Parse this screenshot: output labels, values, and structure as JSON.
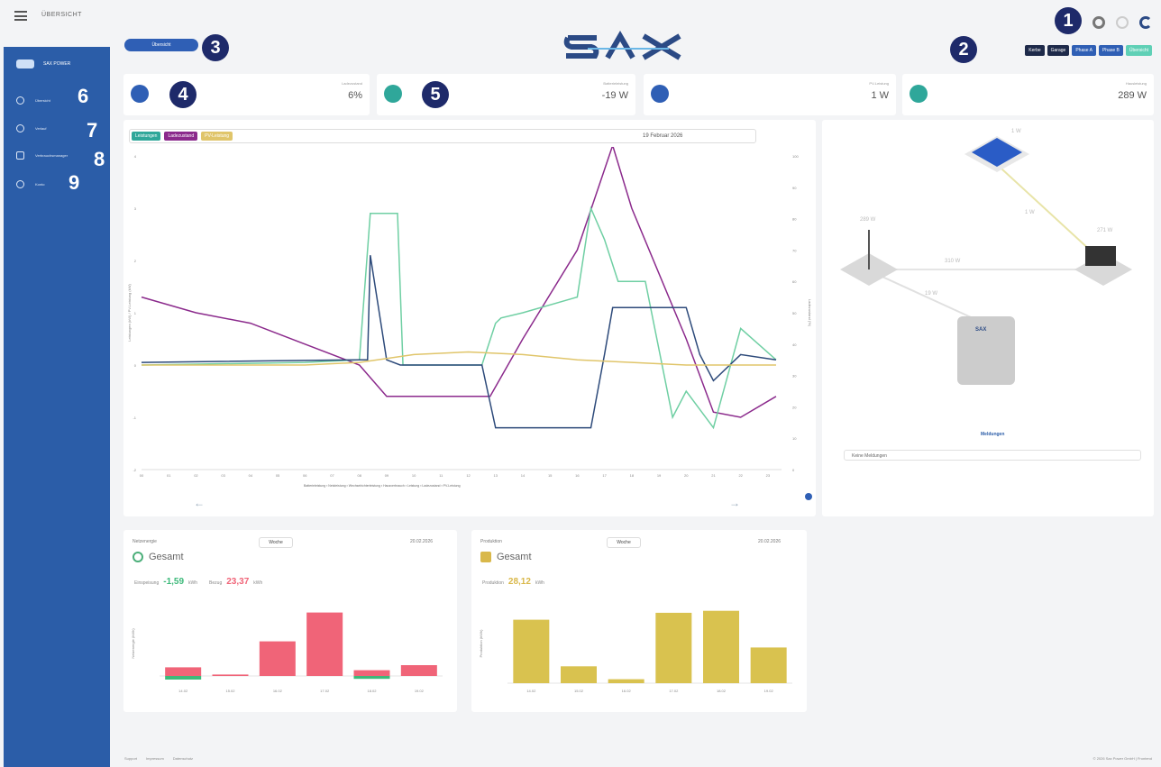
{
  "header": {
    "breadcrumb": "ÜBERSICHT",
    "logo_text": "SAX"
  },
  "sidebar": {
    "brand": "SAX POWER",
    "items": [
      {
        "label": "Übersicht"
      },
      {
        "label": "Verlauf"
      },
      {
        "label": "Verbrauchsmanager"
      },
      {
        "label": "Konto"
      }
    ]
  },
  "overview_pill": "Übersicht",
  "phase_buttons": [
    "Kerbe",
    "Garage",
    "Phase A",
    "Phase B",
    "Übersicht"
  ],
  "stats": [
    {
      "label": "Ladezustand",
      "value": "6%"
    },
    {
      "label": "Batterieleistung",
      "value": "-19 W"
    },
    {
      "label": "PV-Leistung",
      "value": "1 W"
    },
    {
      "label": "Hausleistung",
      "value": "289 W"
    }
  ],
  "chart": {
    "chips": [
      "Leistungen",
      "Ladezustand",
      "PV-Leistung"
    ],
    "date": "19 Februar 2026",
    "legend_text": "Batterieleistung ▪ Netzleistung ▪ Wechselrichterleistung ▪ Hausverbrauch ▪ Leistung ▪ Ladezustand ▪ PV-Leistung"
  },
  "chart_data": {
    "type": "line",
    "title": "",
    "ylabel": "Leistungen (kW) / PV-Leistung (kW)",
    "y2label": "Ladezustand (%)",
    "ylim": [
      -2,
      4
    ],
    "y2lim": [
      0,
      100
    ],
    "x_ticks": [
      "00",
      "01",
      "02",
      "03",
      "04",
      "05",
      "06",
      "07",
      "08",
      "09",
      "10",
      "11",
      "12",
      "13",
      "14",
      "15",
      "16",
      "17",
      "18",
      "19",
      "20",
      "21",
      "22",
      "23"
    ],
    "yticks": [
      -2,
      -1,
      0,
      1,
      2,
      3,
      4
    ],
    "y2ticks": [
      0,
      10,
      20,
      30,
      40,
      50,
      60,
      70,
      80,
      90,
      100
    ],
    "series": [
      {
        "color": "#8b2a8c",
        "x": [
          0,
          2,
          4,
          6,
          8,
          9,
          11,
          12.8,
          14,
          16,
          17.3,
          18,
          20,
          21,
          22,
          23.3
        ],
        "y": [
          1.3,
          1.0,
          0.8,
          0.4,
          0.0,
          -0.6,
          -0.6,
          -0.6,
          0.5,
          2.2,
          4.2,
          3.0,
          0.5,
          -0.9,
          -1.0,
          -0.6
        ]
      },
      {
        "color": "#6fcfa3",
        "x": [
          0,
          6,
          8,
          8.4,
          9.4,
          9.6,
          11,
          12.5,
          13,
          13.2,
          14,
          16,
          16.5,
          17,
          17.5,
          18.5,
          19.5,
          20,
          21,
          22,
          23.3
        ],
        "y": [
          0,
          0.05,
          0.1,
          2.9,
          2.9,
          0,
          0,
          0,
          0.8,
          0.9,
          1.0,
          1.3,
          3.0,
          2.4,
          1.6,
          1.6,
          -1.0,
          -0.5,
          -1.2,
          0.7,
          0.1
        ]
      },
      {
        "color": "#2d4a7a",
        "x": [
          0,
          8,
          8.3,
          8.4,
          9,
          9.5,
          11,
          12.5,
          13,
          16.5,
          17,
          17.3,
          20,
          20.5,
          21,
          22,
          23.3
        ],
        "y": [
          0.05,
          0.1,
          0.1,
          2.1,
          0.1,
          0,
          0,
          0,
          -1.2,
          -1.2,
          0.2,
          1.1,
          1.1,
          0.2,
          -0.3,
          0.2,
          0.1
        ]
      },
      {
        "color": "#e0c56a",
        "x": [
          0,
          6,
          8,
          10,
          12,
          14,
          16,
          18,
          20,
          23.3
        ],
        "y": [
          0,
          0,
          0.05,
          0.2,
          0.25,
          0.2,
          0.1,
          0.05,
          0,
          0
        ]
      }
    ]
  },
  "flow": {
    "pv_label": "1 W",
    "pv_to_house": "1 W",
    "grid_label": "289 W",
    "grid_to_house": "310 W",
    "house_label": "271 W",
    "battery_flow": "19 W",
    "battery_logo": "SAX"
  },
  "meldungen": {
    "title": "Meldungen",
    "item": "Keine Meldungen"
  },
  "bottom_left": {
    "meta": "Netzenergie",
    "title": "Gesamt",
    "week_btn": "Woche",
    "date": "20.02.2026",
    "feed_in_label": "Einspeisung",
    "feed_in_value": "-1,59",
    "feed_in_unit": "kWh",
    "consumption_label": "Bezug",
    "consumption_value": "23,37",
    "consumption_unit": "kWh",
    "ylabel": "Netzenergie (kWh)"
  },
  "bottom_right": {
    "meta": "Produktion",
    "title": "Gesamt",
    "week_btn": "Woche",
    "date": "20.02.2026",
    "prod_label": "Produktion",
    "prod_value": "28,12",
    "prod_unit": "kWh",
    "ylabel": "Produktion (kWh)"
  },
  "bar_left_data": {
    "type": "bar",
    "categories": [
      "14.02",
      "15.02",
      "16.02",
      "17.02",
      "18.02",
      "19.02"
    ],
    "series": [
      {
        "values": [
          1.2,
          0.2,
          4.8,
          8.8,
          0.8,
          1.5
        ]
      },
      {
        "values": [
          -0.5,
          0,
          0,
          0,
          -0.4,
          0
        ]
      }
    ],
    "ylim": [
      -1,
      10
    ]
  },
  "bar_right_data": {
    "type": "bar",
    "categories": [
      "14.02",
      "15.02",
      "16.02",
      "17.02",
      "18.02",
      "19.02"
    ],
    "values": [
      6.4,
      1.7,
      0.4,
      7.1,
      7.3,
      3.6
    ],
    "ylim": [
      0,
      8
    ]
  },
  "footer": {
    "links": [
      "Support",
      "Impressum",
      "Datenschutz"
    ],
    "copyright": "© 2026 Sax Power GmbH | Frontend"
  },
  "markers": [
    "1",
    "2",
    "3",
    "4",
    "5",
    "6",
    "7",
    "8",
    "9"
  ]
}
